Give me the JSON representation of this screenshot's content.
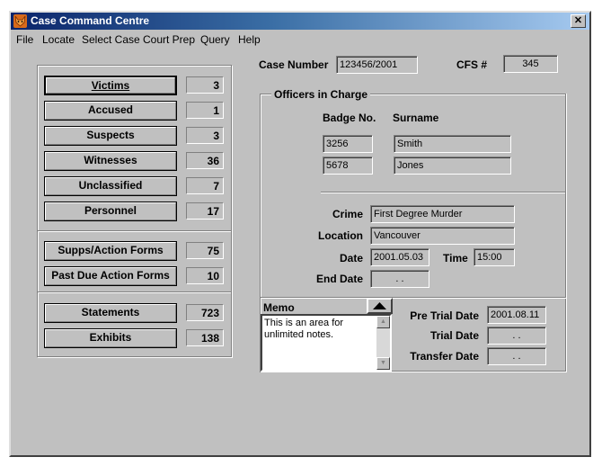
{
  "window": {
    "title": "Case Command Centre",
    "close_glyph": "✕"
  },
  "menu": [
    "File",
    "Locate",
    "Select Case",
    "Court Prep",
    "Query",
    "Help"
  ],
  "counts": [
    {
      "label": "Victims",
      "value": "3"
    },
    {
      "label": "Accused",
      "value": "1"
    },
    {
      "label": "Suspects",
      "value": "3"
    },
    {
      "label": "Witnesses",
      "value": "36"
    },
    {
      "label": "Unclassified",
      "value": "7"
    },
    {
      "label": "Personnel",
      "value": "17"
    },
    {
      "label": "Supps/Action Forms",
      "value": "75"
    },
    {
      "label": "Past Due Action Forms",
      "value": "10"
    },
    {
      "label": "Statements",
      "value": "723"
    },
    {
      "label": "Exhibits",
      "value": "138"
    }
  ],
  "case": {
    "case_number_label": "Case Number",
    "case_number": "123456/2001",
    "cfs_label": "CFS #",
    "cfs": "345"
  },
  "officers": {
    "group_label": "Officers in Charge",
    "badge_header": "Badge No.",
    "surname_header": "Surname",
    "rows": [
      {
        "badge": "3256",
        "surname": "Smith"
      },
      {
        "badge": "5678",
        "surname": "Jones"
      }
    ]
  },
  "details": {
    "crime_label": "Crime",
    "crime": "First Degree Murder",
    "location_label": "Location",
    "location": "Vancouver",
    "date_label": "Date",
    "date": "2001.05.03",
    "time_label": "Time",
    "time": "15:00",
    "end_date_label": "End Date",
    "end_date": ". ."
  },
  "memo": {
    "label": "Memo",
    "text": "This is an area for unlimited notes."
  },
  "trial": {
    "pre_trial_label": "Pre Trial Date",
    "pre_trial": "2001.08.11",
    "trial_label": "Trial Date",
    "trial": ". .",
    "transfer_label": "Transfer Date",
    "transfer": ". ."
  },
  "colors": {
    "face": "#c0c0c0",
    "title_start": "#0a246a",
    "title_end": "#a6caf0"
  }
}
